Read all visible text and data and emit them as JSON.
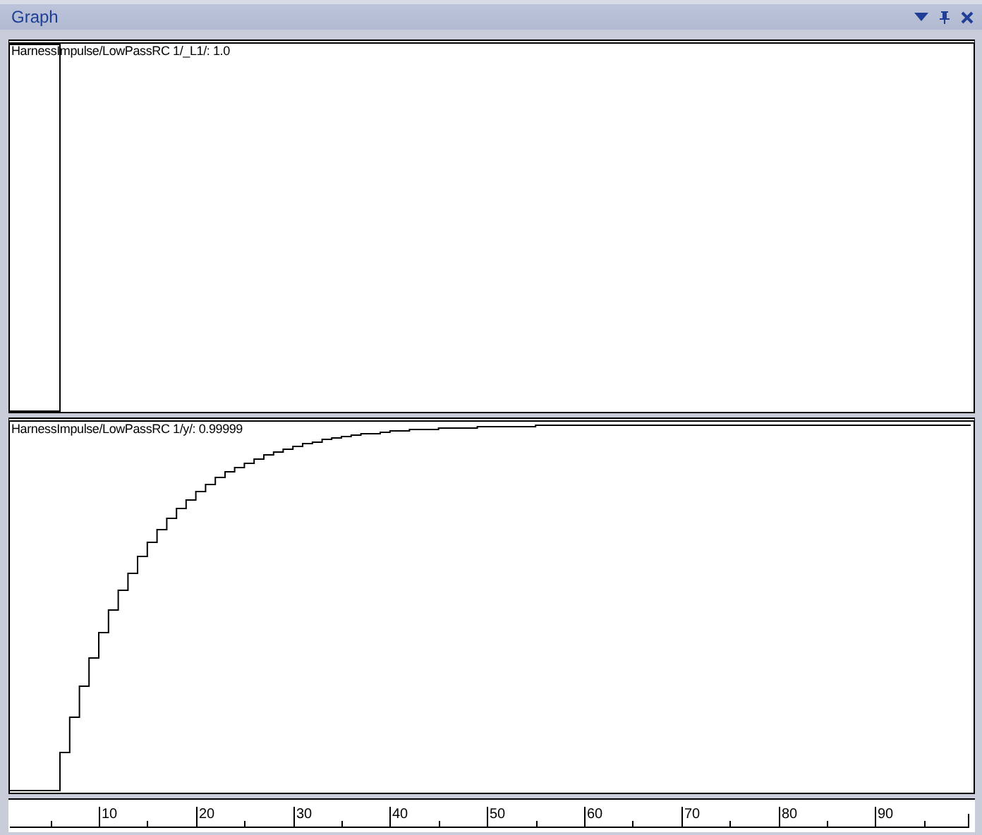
{
  "window": {
    "title": "Graph"
  },
  "plots": [
    {
      "label": "HarnessImpulse/LowPassRC 1/_L1/: 1.0",
      "kind": "impulse"
    },
    {
      "label": "HarnessImpulse/LowPassRC 1/y/: 0.99999",
      "kind": "step"
    }
  ],
  "x_axis": {
    "tick_labels": [
      "10",
      "20",
      "30",
      "40",
      "50",
      "60",
      "70",
      "80",
      "90"
    ]
  }
}
